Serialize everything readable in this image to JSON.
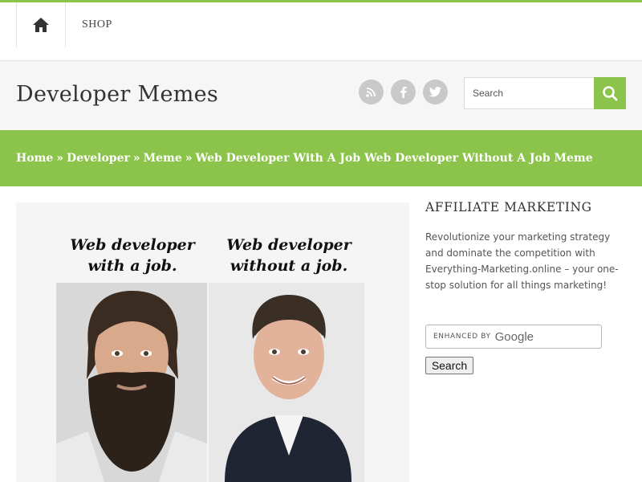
{
  "nav": {
    "home_icon": "home-icon",
    "shop_label": "SHOP"
  },
  "header": {
    "site_title": "Developer Memes",
    "social_icons": [
      "rss-icon",
      "facebook-icon",
      "twitter-icon"
    ],
    "search": {
      "placeholder": "Search",
      "button_icon": "search-icon"
    }
  },
  "breadcrumb": {
    "items": [
      "Home",
      "Developer",
      "Meme"
    ],
    "separator": "»",
    "current": "Web Developer With A Job Web Developer Without A Job Meme"
  },
  "meme": {
    "caption_left_line1": "Web developer",
    "caption_left_line2": "with a job.",
    "caption_right_line1": "Web developer",
    "caption_right_line2": "without a job."
  },
  "sidebar": {
    "title": "AFFILIATE MARKETING",
    "text": "Revolutionize your marketing strategy and dominate the competition with Everything-Marketing.online – your one-stop solution for all things marketing!",
    "custom_search": {
      "enhanced_by": "ENHANCED BY",
      "google": "Google",
      "button_label": "Search"
    }
  },
  "colors": {
    "accent": "#8cc34a",
    "header_bg": "#f6f6f6",
    "social_bg": "#c9c9c9"
  }
}
